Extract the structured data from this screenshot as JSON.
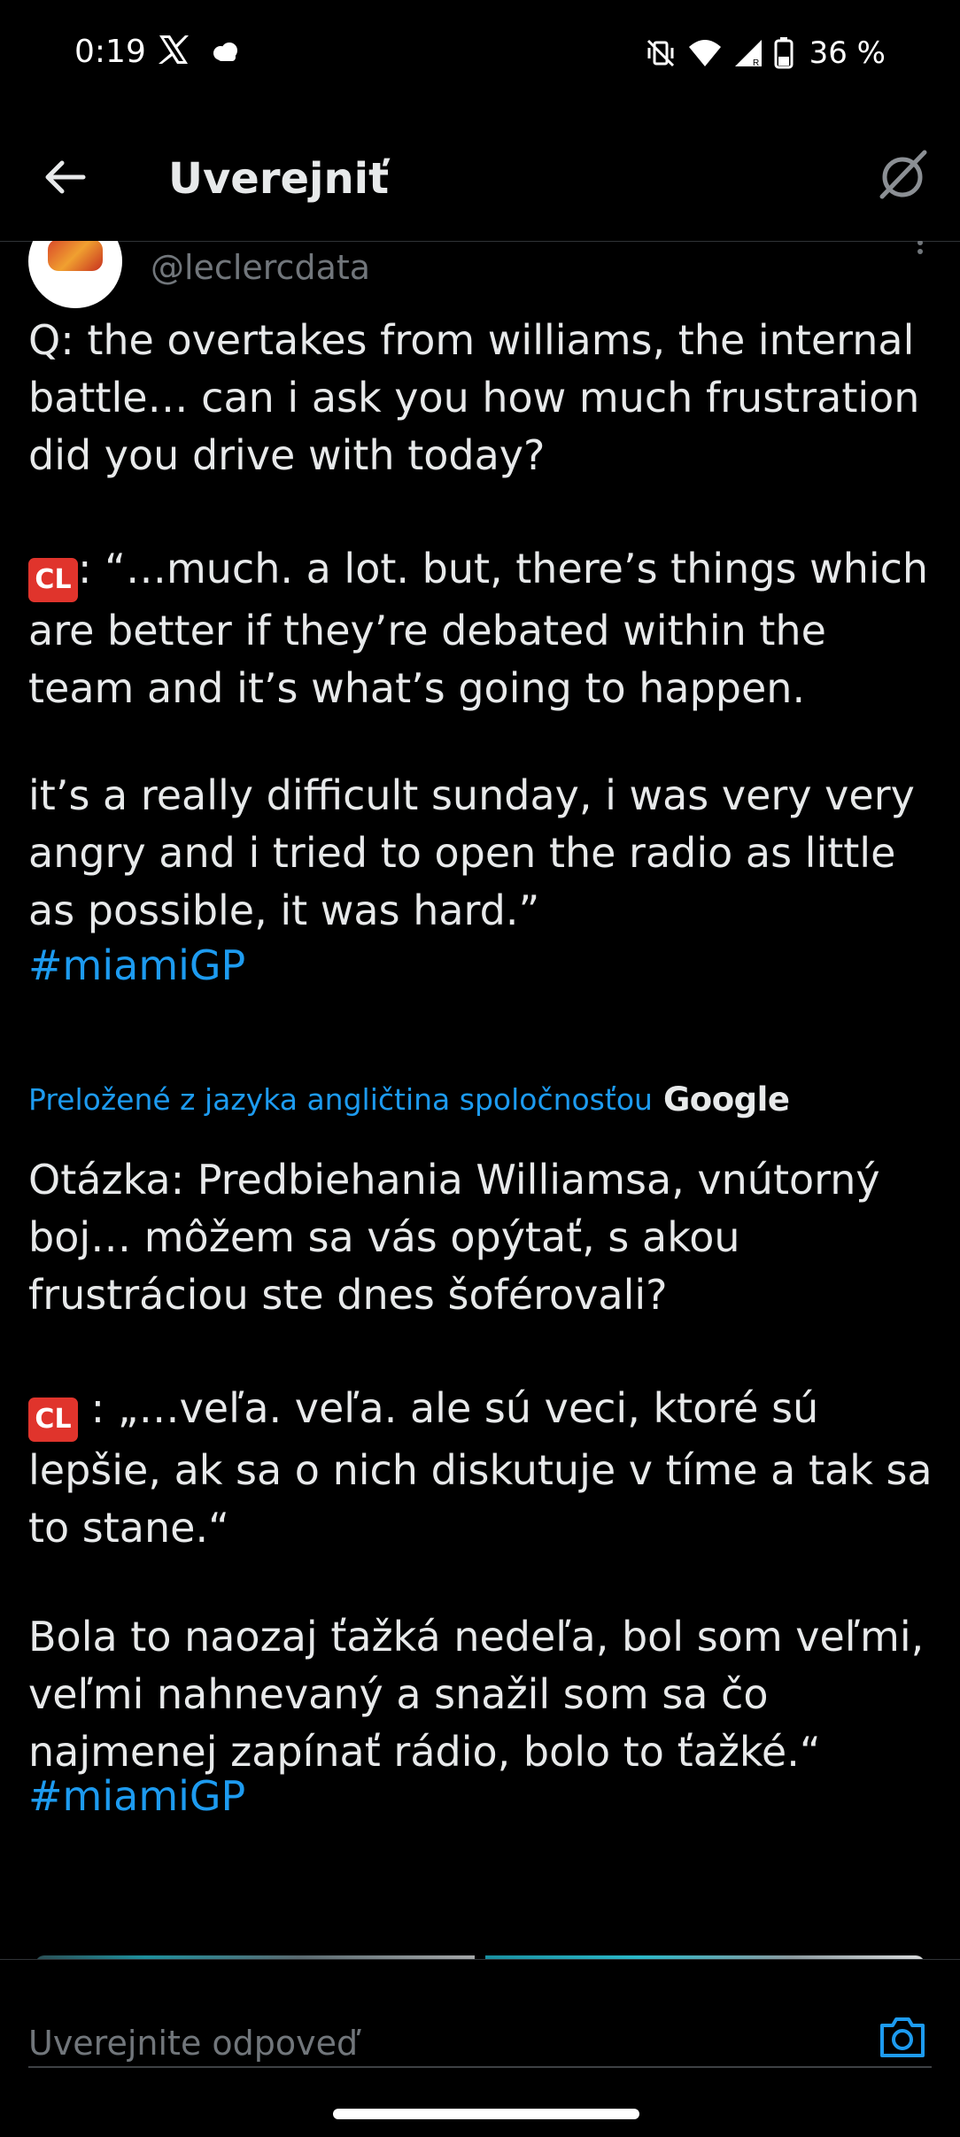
{
  "status_bar": {
    "time": "0:19",
    "battery_text": "36 %",
    "icons": [
      "x-logo-icon",
      "cloud-notification-icon",
      "vibrate-off-icon",
      "wifi-icon",
      "cell-signal-icon",
      "battery-icon"
    ]
  },
  "header": {
    "title": "Uverejniť",
    "back_icon": "arrow-left-icon",
    "grok_icon": "grok-icon"
  },
  "tweet": {
    "handle": "@leclercdata",
    "paragraph_1": "Q: the overtakes from williams, the internal battle… can i ask you how much frustration did you drive with today?",
    "paragraph_2_badge": "CL",
    "paragraph_2": ": “…much. a lot. but, there’s things which are better if they’re debated within the team and it’s what’s going to happen.",
    "paragraph_3": "it’s a really difficult sunday, i was very very angry and i tried to open the radio as little as possible, it was hard.”",
    "hashtag": "#miamiGP",
    "translation_note": "Preložené z jazyka angličtina spoločnosťou",
    "translation_brand": "Google",
    "translated_paragraph_1": "Otázka: Predbiehania Williamsa, vnútorný boj… môžem sa vás opýtať, s akou frustráciou ste dnes šoférovali?",
    "translated_paragraph_2_badge": "CL",
    "translated_paragraph_2": " : „…veľa. veľa. ale sú veci, ktoré sú lepšie, ak sa o nich diskutuje v tíme a tak sa to stane.“",
    "translated_paragraph_3": "Bola to naozaj ťažká nedeľa, bol som veľmi, veľmi nahnevaný a snažil som sa čo najmenej zapínať rádio, bolo to ťažké.“",
    "translated_hashtag": "#miamiGP"
  },
  "reply": {
    "placeholder": "Uverejnite odpoveď",
    "camera_icon": "camera-icon"
  },
  "colors": {
    "background": "#000000",
    "text": "#e7e9ea",
    "secondary_text": "#71767b",
    "accent": "#1d9bf0",
    "badge": "#e0342c"
  }
}
